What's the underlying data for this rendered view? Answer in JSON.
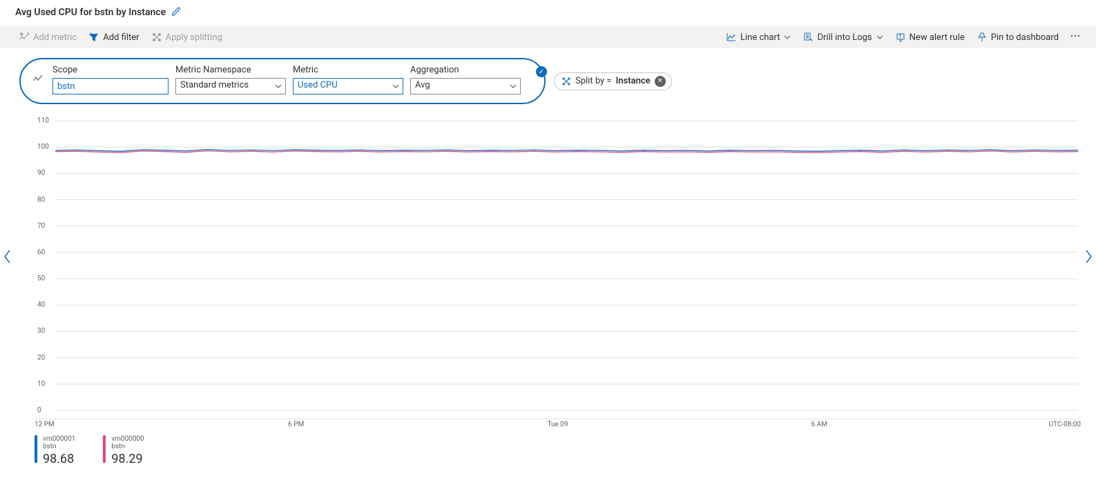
{
  "header": {
    "title": "Avg Used CPU for bstn by Instance"
  },
  "toolbar": {
    "add_metric": "Add metric",
    "add_filter": "Add filter",
    "apply_splitting": "Apply splitting",
    "line_chart": "Line chart",
    "drill_logs": "Drill into Logs",
    "new_alert": "New alert rule",
    "pin_dashboard": "Pin to dashboard"
  },
  "config": {
    "scope_label": "Scope",
    "scope_value": "bstn",
    "ns_label": "Metric Namespace",
    "ns_value": "Standard metrics",
    "metric_label": "Metric",
    "metric_value": "Used CPU",
    "agg_label": "Aggregation",
    "agg_value": "Avg",
    "splitby_prefix": "Split by = ",
    "splitby_value": "Instance"
  },
  "legend": {
    "items": [
      {
        "name": "vm000001",
        "sub": "bstn",
        "value": "98.68"
      },
      {
        "name": "vm000000",
        "sub": "bstn",
        "value": "98.29"
      }
    ]
  },
  "axes": {
    "tz": "UTC-08:00"
  },
  "chart_data": {
    "type": "line",
    "title": "Avg Used CPU for bstn by Instance",
    "xlabel": "",
    "ylabel": "",
    "ylim": [
      0,
      110
    ],
    "yticks": [
      0,
      10,
      20,
      30,
      40,
      50,
      60,
      70,
      80,
      90,
      100,
      110
    ],
    "x_labels": [
      "12 PM",
      "6 PM",
      "Tue 09",
      "6 AM"
    ],
    "x": [
      0,
      1,
      2,
      3,
      4,
      5,
      6,
      7,
      8,
      9,
      10,
      11,
      12,
      13,
      14,
      15,
      16,
      17,
      18,
      19,
      20,
      21,
      22,
      23,
      24,
      25,
      26,
      27,
      28,
      29,
      30,
      31,
      32,
      33,
      34,
      35,
      36,
      37,
      38,
      39,
      40,
      41,
      42,
      43,
      44,
      45,
      46,
      47
    ],
    "series": [
      {
        "name": "vm000001",
        "color": "#0f6cbd",
        "values": [
          98.7,
          98.9,
          98.6,
          98.4,
          99.0,
          98.8,
          98.5,
          99.1,
          98.7,
          98.9,
          98.6,
          99.0,
          98.8,
          98.7,
          98.9,
          98.6,
          98.8,
          98.7,
          98.9,
          98.6,
          98.8,
          98.7,
          98.9,
          98.6,
          98.8,
          98.7,
          98.5,
          98.8,
          98.6,
          98.7,
          98.5,
          98.8,
          98.6,
          98.7,
          98.5,
          98.4,
          98.6,
          98.8,
          98.5,
          98.9,
          98.6,
          98.9,
          98.7,
          99.0,
          98.6,
          98.9,
          98.7,
          98.8
        ]
      },
      {
        "name": "vm000000",
        "color": "#e8467c",
        "values": [
          98.3,
          98.4,
          98.1,
          97.9,
          98.5,
          98.3,
          98.0,
          98.6,
          98.2,
          98.4,
          98.1,
          98.5,
          98.3,
          98.2,
          98.4,
          98.1,
          98.3,
          98.2,
          98.4,
          98.1,
          98.3,
          98.2,
          98.4,
          98.1,
          98.3,
          98.2,
          98.0,
          98.3,
          98.1,
          98.2,
          98.0,
          98.3,
          98.1,
          98.2,
          98.0,
          97.9,
          98.1,
          98.3,
          98.0,
          98.4,
          98.1,
          98.4,
          98.2,
          98.5,
          98.1,
          98.4,
          98.2,
          98.3
        ]
      }
    ]
  }
}
